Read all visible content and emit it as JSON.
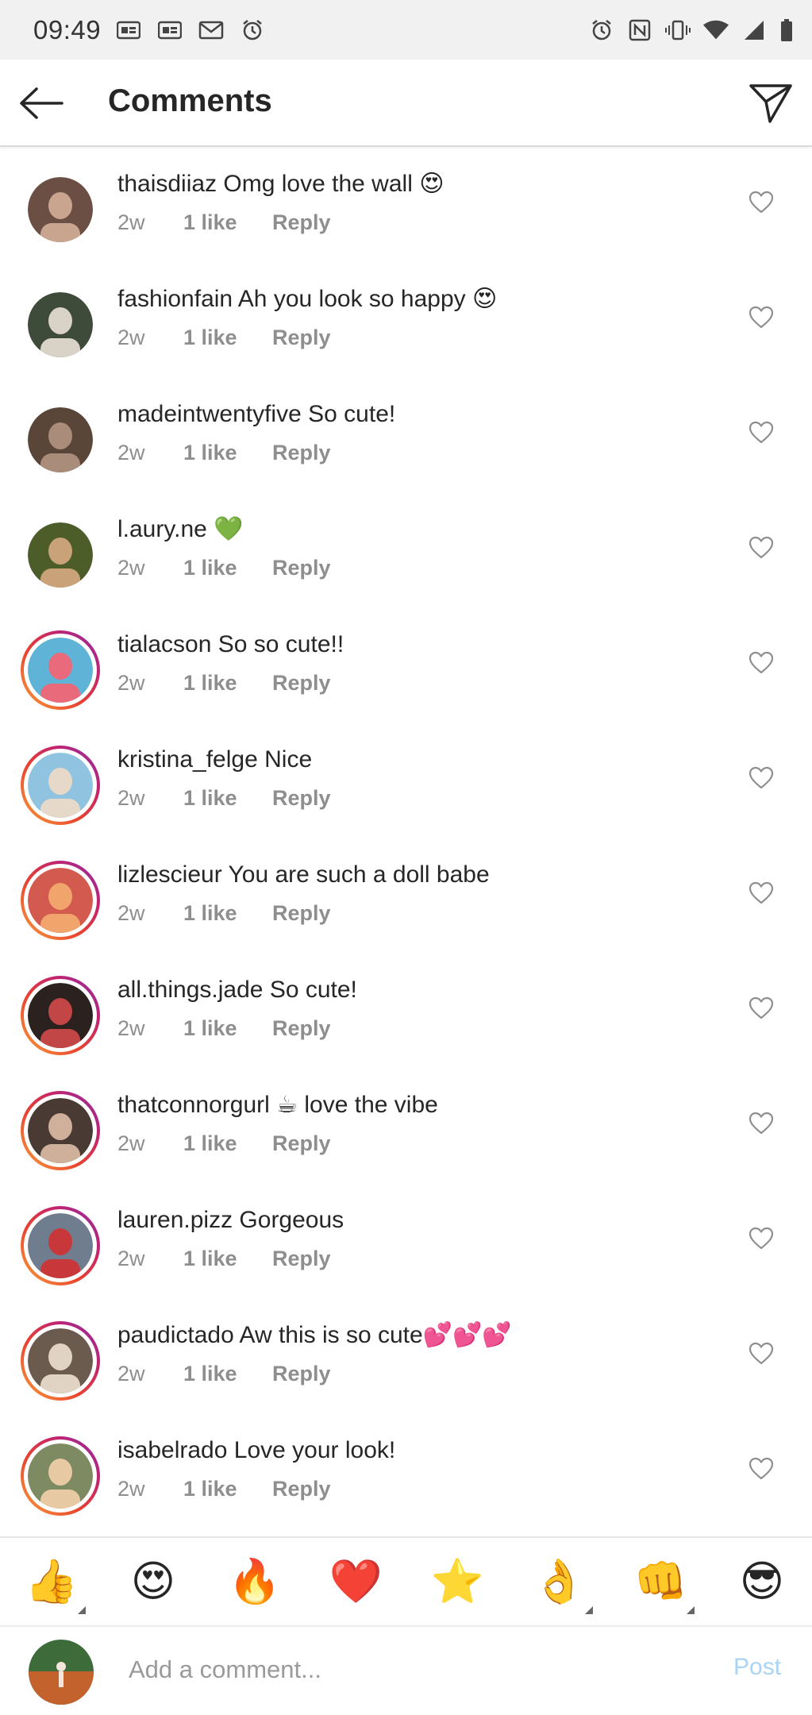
{
  "status_bar": {
    "time": "09:49",
    "left_icons": [
      "gmail-news-icon",
      "gmail-news-icon",
      "mail-icon",
      "alarm-icon"
    ],
    "right_icons": [
      "alarm-icon",
      "nfc-icon",
      "vibrate-icon",
      "wifi-icon",
      "signal-icon",
      "battery-icon"
    ]
  },
  "header": {
    "title": "Comments",
    "back_icon": "back-arrow-icon",
    "send_icon": "send-icon"
  },
  "comments": [
    {
      "username": "thaisdiiaz",
      "text": "Omg love the wall 😍",
      "time": "2w",
      "likes": "1 like",
      "reply": "Reply",
      "story_ring": false,
      "avatar_colors": [
        "#6b4f44",
        "#c9a58f"
      ]
    },
    {
      "username": "fashionfain",
      "text": "Ah you look so happy 😍",
      "time": "2w",
      "likes": "1 like",
      "reply": "Reply",
      "story_ring": false,
      "avatar_colors": [
        "#3e4a3a",
        "#d9d2c7"
      ]
    },
    {
      "username": "madeintwentyfive",
      "text": "So cute!",
      "time": "2w",
      "likes": "1 like",
      "reply": "Reply",
      "story_ring": false,
      "avatar_colors": [
        "#5a4638",
        "#a98c79"
      ]
    },
    {
      "username": "l.aury.ne",
      "text": "💚",
      "time": "2w",
      "likes": "1 like",
      "reply": "Reply",
      "story_ring": false,
      "avatar_colors": [
        "#4d5d2a",
        "#c9a27a"
      ]
    },
    {
      "username": "tialacson",
      "text": "So so cute!!",
      "time": "2w",
      "likes": "1 like",
      "reply": "Reply",
      "story_ring": true,
      "avatar_colors": [
        "#5fb3d6",
        "#e96a7a"
      ]
    },
    {
      "username": "kristina_felge",
      "text": "Nice",
      "time": "2w",
      "likes": "1 like",
      "reply": "Reply",
      "story_ring": true,
      "avatar_colors": [
        "#8fc3e0",
        "#e7d9c9"
      ]
    },
    {
      "username": "lizlescieur",
      "text": "You are such a doll babe",
      "time": "2w",
      "likes": "1 like",
      "reply": "Reply",
      "story_ring": true,
      "avatar_colors": [
        "#d35a4f",
        "#f1a46c"
      ]
    },
    {
      "username": "all.things.jade",
      "text": "So cute!",
      "time": "2w",
      "likes": "1 like",
      "reply": "Reply",
      "story_ring": true,
      "avatar_colors": [
        "#2b2220",
        "#c24646"
      ]
    },
    {
      "username": "thatconnorgurl",
      "text": "☕ love the vibe",
      "time": "2w",
      "likes": "1 like",
      "reply": "Reply",
      "story_ring": true,
      "avatar_colors": [
        "#4a3a34",
        "#cfb19b"
      ]
    },
    {
      "username": "lauren.pizz",
      "text": "Gorgeous",
      "time": "2w",
      "likes": "1 like",
      "reply": "Reply",
      "story_ring": true,
      "avatar_colors": [
        "#6f7d8e",
        "#c8373a"
      ]
    },
    {
      "username": "paudictado",
      "text": "Aw this is so cute💕💕💕",
      "time": "2w",
      "likes": "1 like",
      "reply": "Reply",
      "story_ring": true,
      "avatar_colors": [
        "#6b5a4e",
        "#e1d3c4"
      ]
    },
    {
      "username": "isabelrado",
      "text": "Love your look!",
      "time": "2w",
      "likes": "1 like",
      "reply": "Reply",
      "story_ring": true,
      "avatar_colors": [
        "#7d8a62",
        "#e7c9a3"
      ]
    }
  ],
  "emoji_bar": [
    {
      "emoji": "👍",
      "has_variants": true
    },
    {
      "emoji": "😍",
      "has_variants": false
    },
    {
      "emoji": "🔥",
      "has_variants": false
    },
    {
      "emoji": "❤️",
      "has_variants": false
    },
    {
      "emoji": "⭐",
      "has_variants": false
    },
    {
      "emoji": "👌",
      "has_variants": true
    },
    {
      "emoji": "👊",
      "has_variants": true
    },
    {
      "emoji": "😎",
      "has_variants": false
    }
  ],
  "composer": {
    "placeholder": "Add a comment...",
    "post_label": "Post",
    "avatar_colors": [
      "#3d6b3a",
      "#c4622e"
    ]
  },
  "colors": {
    "text": "#262626",
    "secondary": "#8e8e8e",
    "post_disabled": "#a9d4f5",
    "story_ring": [
      "#f9a33b",
      "#e9432f",
      "#c4246c",
      "#8a2ea8"
    ]
  }
}
